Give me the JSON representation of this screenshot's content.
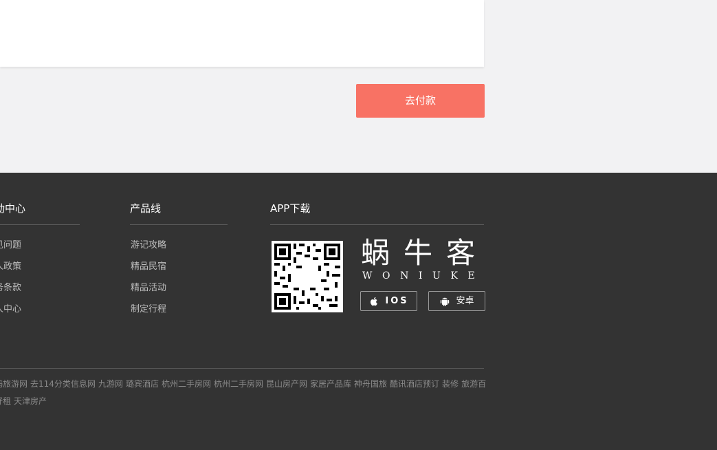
{
  "order": {
    "pay_button": "去付款"
  },
  "footer": {
    "columns": [
      {
        "title": "动中心",
        "links": [
          "见问题",
          "人政策",
          "务条款",
          "人中心"
        ]
      },
      {
        "title": "产品线",
        "links": [
          "游记攻略",
          "精品民宿",
          "精品活动",
          "制定行程"
        ]
      }
    ],
    "app": {
      "title": "APP下载",
      "logo_cn": "蜗牛客",
      "logo_en": "WONIUKE",
      "ios_label": "IOS",
      "android_label": "安卓"
    },
    "friend_links_row1": [
      "蚂旅游网",
      "去114分类信息网",
      "九游网",
      "璐宾酒店",
      "杭州二手房网",
      "杭州二手房网",
      "昆山房产网",
      "家居产品库",
      "神舟国旅",
      "酷讯酒店预订",
      "装修",
      "旅游百"
    ],
    "friend_links_row2": [
      "好租",
      "天津房产"
    ]
  },
  "colors": {
    "accent": "#f87264",
    "footer_bg": "#333333",
    "page_bg": "#f2f2f3"
  }
}
